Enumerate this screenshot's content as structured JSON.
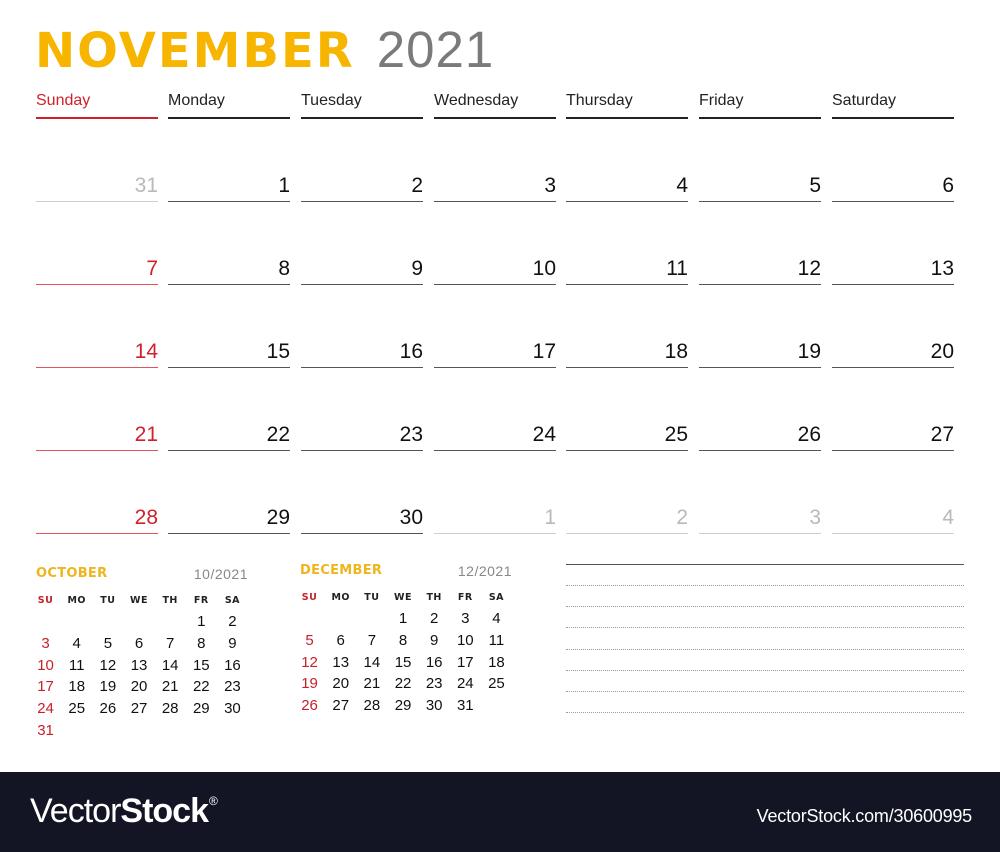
{
  "header": {
    "month": "NOVEMBER",
    "year": "2021",
    "accent_color": "#f7b500",
    "sunday_color": "#d0212b"
  },
  "weekdays": [
    "Sunday",
    "Monday",
    "Tuesday",
    "Wednesday",
    "Thursday",
    "Friday",
    "Saturday"
  ],
  "weeks": [
    [
      {
        "day": "31",
        "muted": true
      },
      {
        "day": "1"
      },
      {
        "day": "2"
      },
      {
        "day": "3"
      },
      {
        "day": "4"
      },
      {
        "day": "5"
      },
      {
        "day": "6"
      }
    ],
    [
      {
        "day": "7"
      },
      {
        "day": "8"
      },
      {
        "day": "9"
      },
      {
        "day": "10"
      },
      {
        "day": "11"
      },
      {
        "day": "12"
      },
      {
        "day": "13"
      }
    ],
    [
      {
        "day": "14"
      },
      {
        "day": "15"
      },
      {
        "day": "16"
      },
      {
        "day": "17"
      },
      {
        "day": "18"
      },
      {
        "day": "19"
      },
      {
        "day": "20"
      }
    ],
    [
      {
        "day": "21"
      },
      {
        "day": "22"
      },
      {
        "day": "23"
      },
      {
        "day": "24"
      },
      {
        "day": "25"
      },
      {
        "day": "26"
      },
      {
        "day": "27"
      }
    ],
    [
      {
        "day": "28"
      },
      {
        "day": "29"
      },
      {
        "day": "30"
      },
      {
        "day": "1",
        "muted": true
      },
      {
        "day": "2",
        "muted": true
      },
      {
        "day": "3",
        "muted": true
      },
      {
        "day": "4",
        "muted": true
      }
    ]
  ],
  "mini_calendars": [
    {
      "name": "OCTOBER",
      "number": "10/2021",
      "weekday_abbr": [
        "SU",
        "MO",
        "TU",
        "WE",
        "TH",
        "FR",
        "SA"
      ],
      "weeks": [
        [
          "",
          "",
          "",
          "",
          "",
          "1",
          "2"
        ],
        [
          "3",
          "4",
          "5",
          "6",
          "7",
          "8",
          "9"
        ],
        [
          "10",
          "11",
          "12",
          "13",
          "14",
          "15",
          "16"
        ],
        [
          "17",
          "18",
          "19",
          "20",
          "21",
          "22",
          "23"
        ],
        [
          "24",
          "25",
          "26",
          "27",
          "28",
          "29",
          "30"
        ],
        [
          "31",
          "",
          "",
          "",
          "",
          "",
          ""
        ]
      ]
    },
    {
      "name": "DECEMBER",
      "number": "12/2021",
      "weekday_abbr": [
        "SU",
        "MO",
        "TU",
        "WE",
        "TH",
        "FR",
        "SA"
      ],
      "weeks": [
        [
          "",
          "",
          "",
          "1",
          "2",
          "3",
          "4"
        ],
        [
          "5",
          "6",
          "7",
          "8",
          "9",
          "10",
          "11"
        ],
        [
          "12",
          "13",
          "14",
          "15",
          "16",
          "17",
          "18"
        ],
        [
          "19",
          "20",
          "21",
          "22",
          "23",
          "24",
          "25"
        ],
        [
          "26",
          "27",
          "28",
          "29",
          "30",
          "31",
          ""
        ]
      ]
    }
  ],
  "notes": {
    "dotted_line_count": 7
  },
  "footer": {
    "brand_light": "Vector",
    "brand_bold": "Stock",
    "brand_mark": "®",
    "url": "VectorStock.com/30600995"
  }
}
